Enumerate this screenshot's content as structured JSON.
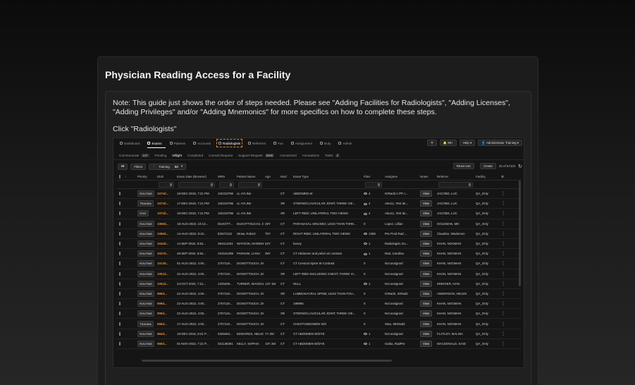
{
  "card": {
    "title": "Physician Reading Access for a Facility",
    "note": "Note: This guide just shows the order of steps needed. Please see \"Adding Facilities for Radiologists\", \"Adding Licenses\", \"Adding Privileges\" and/or \"Adding Mnemonics\" for more specifics on how to complete these steps.",
    "instruction": "Click \"Radiologists\""
  },
  "nav": {
    "items": [
      {
        "label": "Dashboard",
        "icon": "grid-icon"
      },
      {
        "label": "Exams",
        "icon": "doc-icon",
        "active": true
      },
      {
        "label": "Patients",
        "icon": "people-icon"
      },
      {
        "label": "Accounts",
        "icon": "building-icon"
      },
      {
        "label": "Radiologists",
        "icon": "user-icon",
        "highlight": true
      },
      {
        "label": "Referrers",
        "icon": "id-icon"
      },
      {
        "label": "Fax",
        "icon": "fax-icon"
      },
      {
        "label": "Assignment",
        "icon": "assign-icon"
      },
      {
        "label": "Duty",
        "icon": "calendar-icon"
      },
      {
        "label": "Admin",
        "icon": "gear-icon"
      }
    ],
    "notif_count": "99+",
    "help_label": "Help",
    "user_label": "Administrator Training"
  },
  "subtabs": [
    {
      "label": "Communicate",
      "count": "137"
    },
    {
      "label": "Pending"
    },
    {
      "label": "Inflight",
      "active": true
    },
    {
      "label": "Completed"
    },
    {
      "label": "Consult Request"
    },
    {
      "label": "Support Request",
      "count": "8465"
    },
    {
      "label": "Unmatched"
    },
    {
      "label": "Annotations"
    },
    {
      "label": "Tasks",
      "count": "2"
    }
  ],
  "toolbar": {
    "filters_label": "Filters",
    "training_label": "Training",
    "page_size": "50",
    "reset_sort_label": "Reset sort",
    "create_label": "Create",
    "record_count": "20 of 57104"
  },
  "columns": [
    "Priority",
    "DUE",
    "Exam Date (Browser)",
    "MRN",
    "Patient Name",
    "Age",
    "Mod",
    "Exam Type",
    "Files",
    "Assignee",
    "Notes",
    "Referrer",
    "Facility"
  ],
  "rows": [
    {
      "priority": "ROUTINE",
      "due": "1072d...",
      "date": "19-DEC-2016, 7:21 PM",
      "mrn": "102210796",
      "patient": "ui, AYLINe",
      "age": "",
      "mod": "CT",
      "exam": "ABDOMEN W",
      "files": "4",
      "eye": true,
      "assignee": "IGRad3.1-PP, I...",
      "referrer": "JACOBS, LUC",
      "facility": "QA_Only"
    },
    {
      "priority": "TRAUMA",
      "due": "1072d...",
      "date": "17-DEC-2016, 7:21 PM",
      "mrn": "102210796",
      "patient": "ui, AYLINe",
      "age": "",
      "mod": "XR",
      "exam": "STERNOCLAVICULAR JOINT; THREE VIE...",
      "files": "4",
      "eye": true,
      "assignee": "Alex11, Test de...",
      "referrer": "JACOBS, LUC",
      "facility": "QA_Only"
    },
    {
      "priority": "STAT",
      "due": "1072d...",
      "date": "19-DEC-2016, 7:21 PM",
      "mrn": "102210796",
      "patient": "ui, AYLINe",
      "age": "",
      "mod": "XR",
      "exam": "LEFT RIBS; UNILATERAL TWO VIEWS",
      "files": "4",
      "eye": true,
      "assignee": "Alex11, Test de...",
      "referrer": "JACOBS, LUC",
      "facility": "QA_Only"
    },
    {
      "priority": "ROUTINE",
      "due": "1069d...",
      "date": "18-AUG-2022, 10:13...",
      "mrn": "DUKOTT...",
      "patient": "DUKOTTOUCH1, Du...",
      "age": "29Y",
      "mod": "CT",
      "exam": "PARANASAL SINUSES; LESS THAN THRE...",
      "files": "0",
      "eye": false,
      "assignee": "Lopez, Lillian",
      "referrer": "GOLDMAN, MD",
      "facility": "QA_Only"
    },
    {
      "priority": "ROUTINE",
      "due": "1066d...",
      "date": "14-AUG-2022, 8:42...",
      "mrn": "E3572122",
      "patient": "Straw, Robert",
      "age": "70Y",
      "mod": "CT",
      "exam": "RIGHT RIBS; UNILATERAL TWO VIEWS",
      "files": "1308",
      "eye": true,
      "assignee": "Pre Prod Rad ...",
      "referrer": "Claudino, Wederson",
      "facility": "QA_Only"
    },
    {
      "priority": "ROUTINE",
      "due": "1044d...",
      "date": "14-SEP-2022, 8:52...",
      "mrn": "364114202",
      "patient": "WATSON, MAREKE",
      "age": "52Y",
      "mod": "CT",
      "exam": "kenny",
      "files": "1",
      "eye": true,
      "assignee": "Radiologist, Eu...",
      "referrer": "KHAN, NOOMAN",
      "facility": "QA_Only"
    },
    {
      "priority": "ROUTINE",
      "due": "1027d...",
      "date": "28-SEP-2022, 8:52...",
      "mrn": "101541289",
      "patient": "PARSAM, LIANA",
      "age": "38Y",
      "mod": "CT",
      "exam": "CT Abdomen and pelvis w/ contrast",
      "files": "1",
      "eye": true,
      "assignee": "Rad, Carolina",
      "referrer": "KHAN, NOOMAN",
      "facility": "QA_Only"
    },
    {
      "priority": "ROUTINE",
      "due": "1013d...",
      "date": "01-AUG-2022, 4:00...",
      "mrn": "2707119...",
      "patient": "DONOTTOUCH, DON...",
      "age": "",
      "mod": "CT",
      "exam": "CT Cervical Spine W Contrast",
      "files": "0",
      "eye": false,
      "assignee": "Not assigned",
      "referrer": "KHAN, NOOMAN",
      "facility": "QA_Only"
    },
    {
      "priority": "ROUTINE",
      "due": "1001d...",
      "date": "22-AUG-2022, 4:00...",
      "mrn": "2707119...",
      "patient": "DONOTTOUCH, DON...",
      "age": "",
      "mod": "XR",
      "exam": "LEFT RIBS INCLUDING CHEST; THREE VI...",
      "files": "0",
      "eye": false,
      "assignee": "Not assigned",
      "referrer": "KHAN, NOOMAN",
      "facility": "QA_Only"
    },
    {
      "priority": "ROUTINE",
      "due": "1001d...",
      "date": "24-OCT-2022, 7:21...",
      "mrn": "1225269...",
      "patient": "TURNER, MAGDALENA",
      "age": "14Y 1M",
      "mod": "CT",
      "exam": "NULL",
      "files": "1",
      "eye": true,
      "assignee": "Not assigned",
      "referrer": "KREIGER, IVAN",
      "facility": "QA_Only"
    },
    {
      "priority": "ROUTINE",
      "due": "999d...",
      "date": "22-AUG-2022, 4:00...",
      "mrn": "2707119...",
      "patient": "DONOTTOUCH, DON...",
      "age": "",
      "mod": "XR",
      "exam": "LUMBOSACRAL SPINE; LESS THAN FOU...",
      "files": "0",
      "eye": false,
      "assignee": "IGRad2, IGRad2",
      "referrer": "ANDERSON, HELEN",
      "facility": "QA_Only"
    },
    {
      "priority": "ROUTINE",
      "due": "999d...",
      "date": "22-AUG-2022, 4:00...",
      "mrn": "2707119...",
      "patient": "DONOTTOUCH, DON...",
      "age": "",
      "mod": "CT",
      "exam": "199996",
      "files": "0",
      "eye": false,
      "assignee": "Not assigned",
      "referrer": "KHAN, NOOMAN",
      "facility": "QA_Only"
    },
    {
      "priority": "ROUTINE",
      "due": "999d...",
      "date": "22-AUG-2022, 4:00...",
      "mrn": "2707119...",
      "patient": "DONOTTOUCH, DON...",
      "age": "",
      "mod": "XR",
      "exam": "STERNOCLAVICULAR JOINT; THREE VIE...",
      "files": "0",
      "eye": false,
      "assignee": "Not assigned",
      "referrer": "KHAN, NOOMAN",
      "facility": "QA_Only"
    },
    {
      "priority": "TRAUMA",
      "due": "986d...",
      "date": "17-AUG-2022, 4:00...",
      "mrn": "2707119...",
      "patient": "DONOTTOUCH, DON...",
      "age": "",
      "mod": "CT",
      "exam": "CHEST/ABDOMEN WO",
      "files": "0",
      "eye": false,
      "assignee": "Stan, MKRad3",
      "referrer": "KHAN, NOOMAN",
      "facility": "QA_Only"
    },
    {
      "priority": "ROUTINE",
      "due": "984d...",
      "date": "19-DEC-2016, 8:21 P...",
      "mrn": "0329454...",
      "patient": "EDWARDS, NELSON",
      "age": "7Y 2M",
      "mod": "CT",
      "exam": "CT ABDOMEN W/DYE",
      "files": "1",
      "eye": true,
      "assignee": "Not assigned",
      "referrer": "FLATLEY, MALINA",
      "facility": "QA_Only"
    },
    {
      "priority": "ROUTINE",
      "due": "980d...",
      "date": "01-NOV-2022, 7:21 P...",
      "mrn": "021138391",
      "patient": "KELLY, SOPHIA",
      "age": "10Y 2M",
      "mod": "CT",
      "exam": "CT ABDOMEN W/DYE",
      "files": "1",
      "eye": true,
      "assignee": "Gaika, RadPre",
      "referrer": "MACDONALD, SAID",
      "facility": "QA_Only"
    }
  ],
  "view_label": "View"
}
